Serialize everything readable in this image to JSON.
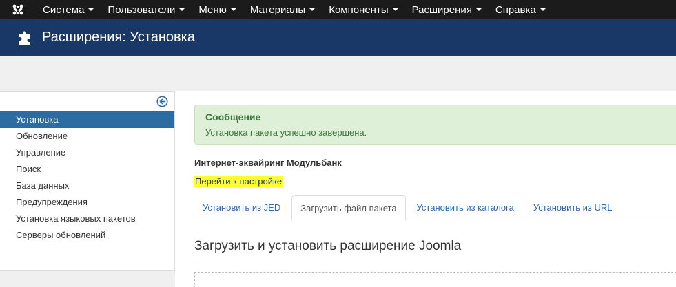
{
  "topnav": {
    "menu": [
      {
        "label": "Система"
      },
      {
        "label": "Пользователи"
      },
      {
        "label": "Меню"
      },
      {
        "label": "Материалы"
      },
      {
        "label": "Компоненты"
      },
      {
        "label": "Расширения"
      },
      {
        "label": "Справка"
      }
    ]
  },
  "header": {
    "title": "Расширения: Установка",
    "icon": "puzzle-icon"
  },
  "sidebar": {
    "items": [
      {
        "label": "Установка",
        "active": true
      },
      {
        "label": "Обновление"
      },
      {
        "label": "Управление"
      },
      {
        "label": "Поиск"
      },
      {
        "label": "База данных"
      },
      {
        "label": "Предупреждения"
      },
      {
        "label": "Установка языковых пакетов"
      },
      {
        "label": "Серверы обновлений"
      }
    ]
  },
  "message": {
    "title": "Сообщение",
    "text": "Установка пакета успешно завершена."
  },
  "extension": {
    "name": "Интернет-эквайринг Модульбанк",
    "config_link": "Перейти к настройке"
  },
  "tabs": [
    {
      "label": "Установить из JED"
    },
    {
      "label": "Загрузить файл пакета",
      "active": true
    },
    {
      "label": "Установить из каталога"
    },
    {
      "label": "Установить из URL"
    }
  ],
  "section": {
    "title": "Загрузить и установить расширение Joomla"
  },
  "colors": {
    "topnav": "#1b1b1b",
    "header": "#1a3867",
    "sidebar_active": "#2d6ca2",
    "alert_bg": "#dff0d8",
    "alert_text": "#3c763d",
    "highlight": "#ffff2e"
  }
}
